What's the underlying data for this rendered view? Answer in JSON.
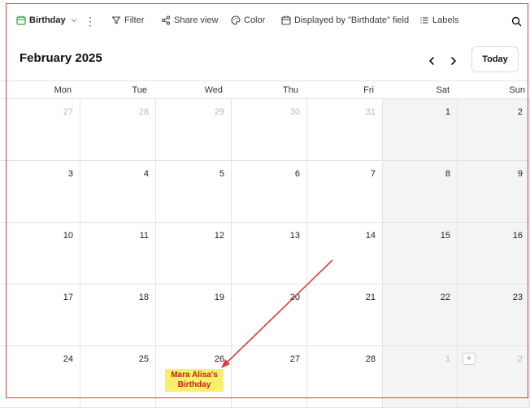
{
  "toolbar": {
    "view_name": "Birthday",
    "more": "⋮",
    "filter": "Filter",
    "share_view": "Share view",
    "color": "Color",
    "displayed_by": "Displayed by \"Birthdate\" field",
    "labels": "Labels"
  },
  "calendar": {
    "month_title": "February 2025",
    "today_label": "Today",
    "weekdays": [
      "Mon",
      "Tue",
      "Wed",
      "Thu",
      "Fri",
      "Sat",
      "Sun"
    ],
    "weeks": [
      [
        {
          "day": "27",
          "muted": true
        },
        {
          "day": "28",
          "muted": true
        },
        {
          "day": "29",
          "muted": true
        },
        {
          "day": "30",
          "muted": true
        },
        {
          "day": "31",
          "muted": true
        },
        {
          "day": "1",
          "muted": false
        },
        {
          "day": "2",
          "muted": false
        }
      ],
      [
        {
          "day": "3",
          "muted": false
        },
        {
          "day": "4",
          "muted": false
        },
        {
          "day": "5",
          "muted": false
        },
        {
          "day": "6",
          "muted": false
        },
        {
          "day": "7",
          "muted": false
        },
        {
          "day": "8",
          "muted": false
        },
        {
          "day": "9",
          "muted": false
        }
      ],
      [
        {
          "day": "10",
          "muted": false
        },
        {
          "day": "11",
          "muted": false
        },
        {
          "day": "12",
          "muted": false
        },
        {
          "day": "13",
          "muted": false
        },
        {
          "day": "14",
          "muted": false
        },
        {
          "day": "15",
          "muted": false
        },
        {
          "day": "16",
          "muted": false
        }
      ],
      [
        {
          "day": "17",
          "muted": false
        },
        {
          "day": "18",
          "muted": false
        },
        {
          "day": "19",
          "muted": false
        },
        {
          "day": "20",
          "muted": false
        },
        {
          "day": "21",
          "muted": false
        },
        {
          "day": "22",
          "muted": false
        },
        {
          "day": "23",
          "muted": false
        }
      ],
      [
        {
          "day": "24",
          "muted": false
        },
        {
          "day": "25",
          "muted": false
        },
        {
          "day": "26",
          "muted": false
        },
        {
          "day": "27",
          "muted": false
        },
        {
          "day": "28",
          "muted": false
        },
        {
          "day": "1",
          "muted": true
        },
        {
          "day": "2",
          "muted": true
        }
      ]
    ],
    "add_button": "+"
  },
  "annotation": {
    "event_label": "Mara Alisa's Birthday",
    "highlight_color": "#f7f06a",
    "text_color": "#d11b1b",
    "frame_color": "#e13b3b"
  },
  "icons": {
    "view": "calendar-icon",
    "view_caret": "chevron-down-icon",
    "filter": "filter-icon",
    "share": "share-icon",
    "color": "palette-icon",
    "displayed_by": "calendar-icon",
    "labels": "list-icon",
    "search": "search-icon",
    "prev": "chevron-left-icon",
    "next": "chevron-right-icon"
  }
}
